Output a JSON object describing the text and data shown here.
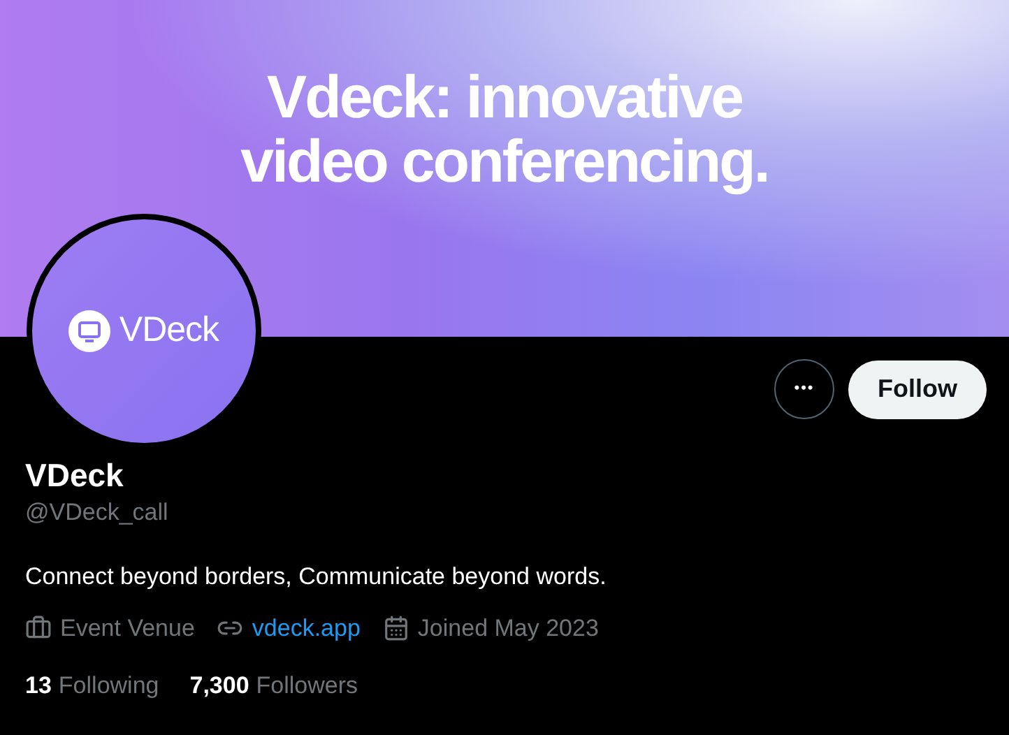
{
  "banner": {
    "headline": [
      "Vdeck: innovative",
      "video conferencing."
    ]
  },
  "avatar": {
    "logo_text": "VDeck"
  },
  "actions": {
    "more": "•••",
    "follow": "Follow"
  },
  "profile": {
    "name": "VDeck",
    "handle": "@VDeck_call",
    "bio": "Connect beyond borders, Communicate beyond words."
  },
  "info": [
    {
      "kind": "category",
      "text": "Event Venue"
    },
    {
      "kind": "link",
      "text": "vdeck.app"
    },
    {
      "kind": "joined",
      "text": "Joined May 2023"
    }
  ],
  "stats": [
    {
      "count": "13",
      "label": "Following"
    },
    {
      "count": "7,300",
      "label": "Followers"
    }
  ]
}
